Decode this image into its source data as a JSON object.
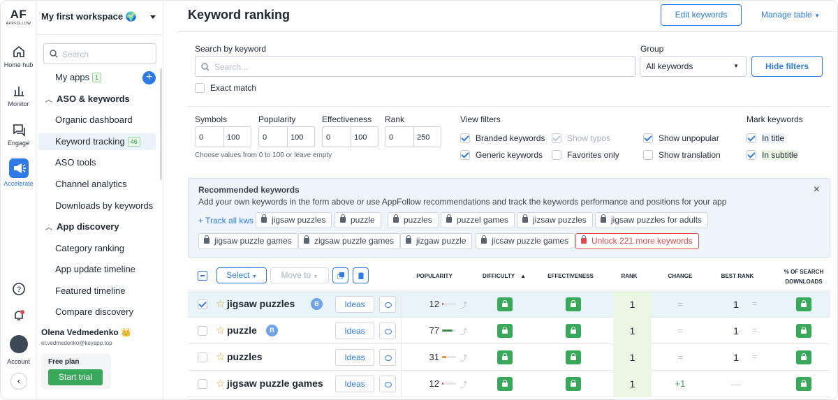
{
  "rail": {
    "logo": "AF",
    "logo_sub": "APPFOLLOW",
    "items": [
      {
        "label": "Home hub",
        "icon": "home-icon"
      },
      {
        "label": "Monitor",
        "icon": "chart-icon"
      },
      {
        "label": "Engage",
        "icon": "chat-icon"
      },
      {
        "label": "Accelerate",
        "icon": "megaphone-icon"
      }
    ],
    "bottom": {
      "account_label": "Account"
    }
  },
  "sidebar": {
    "workspace": "My first workspace 🌍",
    "search_placeholder": "Search",
    "my_apps": "My apps",
    "my_apps_count": "1",
    "aso_section": "ASO & keywords",
    "aso_items": [
      "Organic dashboard",
      "Keyword tracking",
      "ASO tools",
      "Channel analytics",
      "Downloads by keywords"
    ],
    "keyword_tracking_count": "46",
    "discovery_section": "App discovery",
    "discovery_items": [
      "Category ranking",
      "App update timeline",
      "Featured timeline",
      "Compare discovery"
    ],
    "user_name": "Olena Vedmedenko 👑",
    "user_email": "el.vedmedenko@keyapp.top",
    "plan_label": "Free plan",
    "trial_button": "Start trial"
  },
  "header": {
    "title": "Keyword ranking",
    "edit_keywords": "Edit keywords",
    "manage_table": "Manage table"
  },
  "filters": {
    "search_label": "Search by keyword",
    "search_placeholder": "Search...",
    "exact_match": "Exact match",
    "group_label": "Group",
    "group_value": "All keywords",
    "hide_filters": "Hide filters",
    "symbols_label": "Symbols",
    "symbols_min": "0",
    "symbols_max": "100",
    "popularity_label": "Popularity",
    "popularity_min": "0",
    "popularity_max": "100",
    "effectiveness_label": "Effectiveness",
    "effectiveness_min": "0",
    "effectiveness_max": "100",
    "rank_label": "Rank",
    "rank_min": "0",
    "rank_max": "250",
    "range_hint": "Choose values from 0 to 100 or leave empty",
    "view_filters_label": "View filters",
    "branded": "Branded keywords",
    "generic": "Generic keywords",
    "show_typos": "Show typos",
    "favorites_only": "Favorites only",
    "show_unpopular": "Show unpopular",
    "show_translation": "Show translation",
    "mark_keywords_label": "Mark keywords",
    "in_title": "In title",
    "in_subtitle": "In subtitle"
  },
  "recommended": {
    "title": "Recommended keywords",
    "description": "Add your own keywords in the form above or use AppFollow recommendations and track the keywords performance and positions for your app",
    "track_all": "+ Track all kws",
    "chips": [
      "jigsaw puzzles",
      "puzzle",
      "puzzles",
      "puzzel games",
      "jizsaw puzzles",
      "jigsaw puzzles for adults",
      "jigsaw puzzle games",
      "zigsaw puzzle games",
      "jizgaw puzzle",
      "jicsaw puzzle games"
    ],
    "unlock": "Unlock 221 more keywords",
    "close": "×"
  },
  "toolbar": {
    "select": "Select",
    "move_to": "Move to"
  },
  "table": {
    "columns": [
      "POPULARITY",
      "DIFFICULTY",
      "EFFECTIVENESS",
      "RANK",
      "CHANGE",
      "BEST RANK",
      "% OF SEARCH",
      "DOWNLOADS"
    ],
    "ideas_label": "Ideas",
    "rows": [
      {
        "keyword": "jigsaw puzzles",
        "badge": "B",
        "popularity": "12",
        "pop_level": 0.12,
        "pop_color": "#e04a4a",
        "rank": "1",
        "change": "=",
        "best_rank": "1",
        "best_eq": "=",
        "checked": true
      },
      {
        "keyword": "puzzle",
        "badge": "B",
        "popularity": "77",
        "pop_level": 0.77,
        "pop_color": "#3a8a4a",
        "rank": "1",
        "change": "=",
        "best_rank": "1",
        "best_eq": "=",
        "checked": false
      },
      {
        "keyword": "puzzles",
        "badge": "",
        "popularity": "31",
        "pop_level": 0.31,
        "pop_color": "#e9902e",
        "rank": "1",
        "change": "=",
        "best_rank": "1",
        "best_eq": "=",
        "checked": false
      },
      {
        "keyword": "jigsaw puzzle games",
        "badge": "",
        "popularity": "12",
        "pop_level": 0.12,
        "pop_color": "#e04a4a",
        "rank": "1",
        "change": "+1",
        "best_rank": "—",
        "best_eq": "",
        "checked": false
      }
    ]
  },
  "colors": {
    "accent": "#2e7be8",
    "green": "#3aa85a",
    "rank_bg": "#e9f7e3",
    "selected_row": "#e9f4f8"
  }
}
